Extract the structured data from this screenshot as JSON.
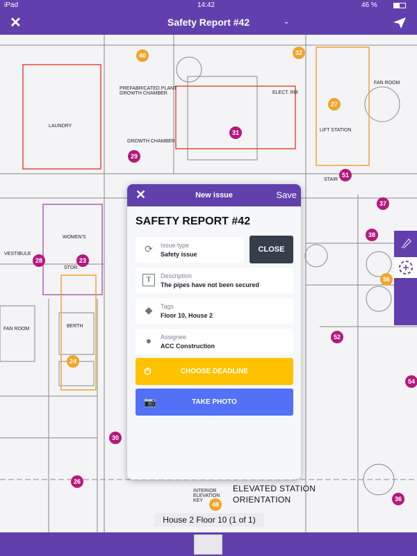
{
  "status_bar": {
    "device": "iPad",
    "time": "14:42",
    "battery": "46 %"
  },
  "nav": {
    "title": "Safety Report #42",
    "close_icon": "close-icon",
    "dropdown_icon": "chevron-down-icon",
    "send_icon": "paper-plane-icon"
  },
  "blueprint": {
    "labels": [
      "LAUNDRY",
      "PREFABRICATED PLANT GROWTH CHAMBER",
      "FAN ROOM",
      "WOMEN'S",
      "VESTIBULE",
      "STOR.",
      "BERTH",
      "ELEVATED STATION",
      "ORIENTATION",
      "INTERIOR ELEVATION KEY",
      "GROWTH CHAMBER",
      "FAN ROOM",
      "ELECT. RM",
      "LIFT STATION",
      "STAIR"
    ],
    "pins": [
      {
        "n": "40",
        "c": "o"
      },
      {
        "n": "32",
        "c": "o"
      },
      {
        "n": "27",
        "c": "o"
      },
      {
        "n": "31",
        "c": "m"
      },
      {
        "n": "29",
        "c": "m"
      },
      {
        "n": "51",
        "c": "m"
      },
      {
        "n": "37",
        "c": "m"
      },
      {
        "n": "38",
        "c": "m"
      },
      {
        "n": "56",
        "c": "o"
      },
      {
        "n": "28",
        "c": "m"
      },
      {
        "n": "23",
        "c": "m"
      },
      {
        "n": "24",
        "c": "o"
      },
      {
        "n": "52",
        "c": "m"
      },
      {
        "n": "54",
        "c": "m"
      },
      {
        "n": "30",
        "c": "m"
      },
      {
        "n": "26",
        "c": "m"
      },
      {
        "n": "48",
        "c": "o"
      },
      {
        "n": "36",
        "c": "m"
      }
    ]
  },
  "modal": {
    "header": {
      "title": "New issue",
      "save": "Save"
    },
    "heading": "SAFETY REPORT #42",
    "close_button": "CLOSE",
    "fields": [
      {
        "label": "Issue type",
        "value": "Safety issue",
        "icon": "issue-type-icon"
      },
      {
        "label": "Description",
        "value": "The pipes have not been secured",
        "icon": "text-icon"
      },
      {
        "label": "Tags",
        "value": "Floor 10, House 2",
        "icon": "tag-icon"
      },
      {
        "label": "Assignee",
        "value": "ACC Construction",
        "icon": "person-icon"
      }
    ],
    "deadline_button": "CHOOSE DEADLINE",
    "photo_button": "TAKE PHOTO"
  },
  "caption": "House 2 Floor 10 (1 of 1)",
  "colors": {
    "brand": "#6140ad",
    "close": "#363d4b",
    "deadline": "#fec200",
    "photo": "#5271f7",
    "pin_orange": "#f2a42a",
    "pin_magenta": "#b5187d"
  }
}
